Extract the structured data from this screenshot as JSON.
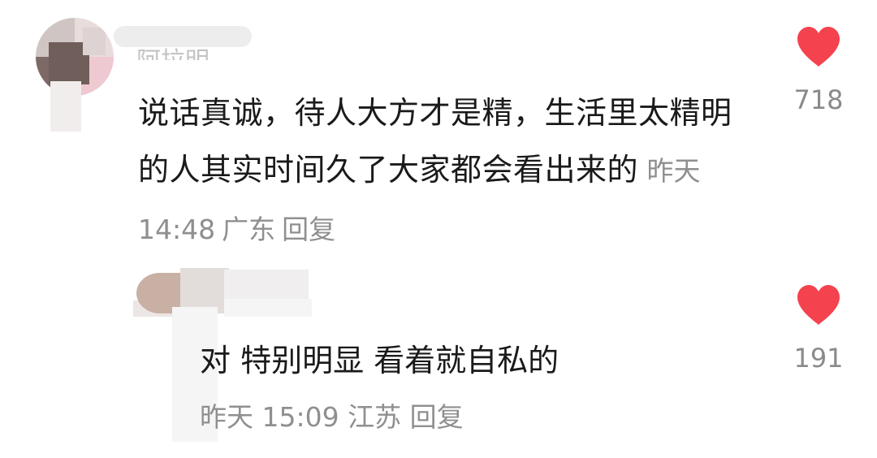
{
  "comments": [
    {
      "username": "阿拉明",
      "text": "说话真诚，待人大方才是精，生活里太精明的人其实时间久了大家都会看出来的",
      "time": "昨天 14:48",
      "location": "广东",
      "reply_label": "回复",
      "likes": "718"
    },
    {
      "text": "对 特别明显 看着就自私的",
      "time": "昨天 15:09",
      "location": "江苏",
      "reply_label": "回复",
      "likes": "191"
    }
  ],
  "icons": {
    "like": "heart-icon"
  },
  "colors": {
    "heart": "#f5424f",
    "text": "#1a1a1a",
    "meta": "#8f8f8f",
    "count": "#8a8a8a"
  }
}
